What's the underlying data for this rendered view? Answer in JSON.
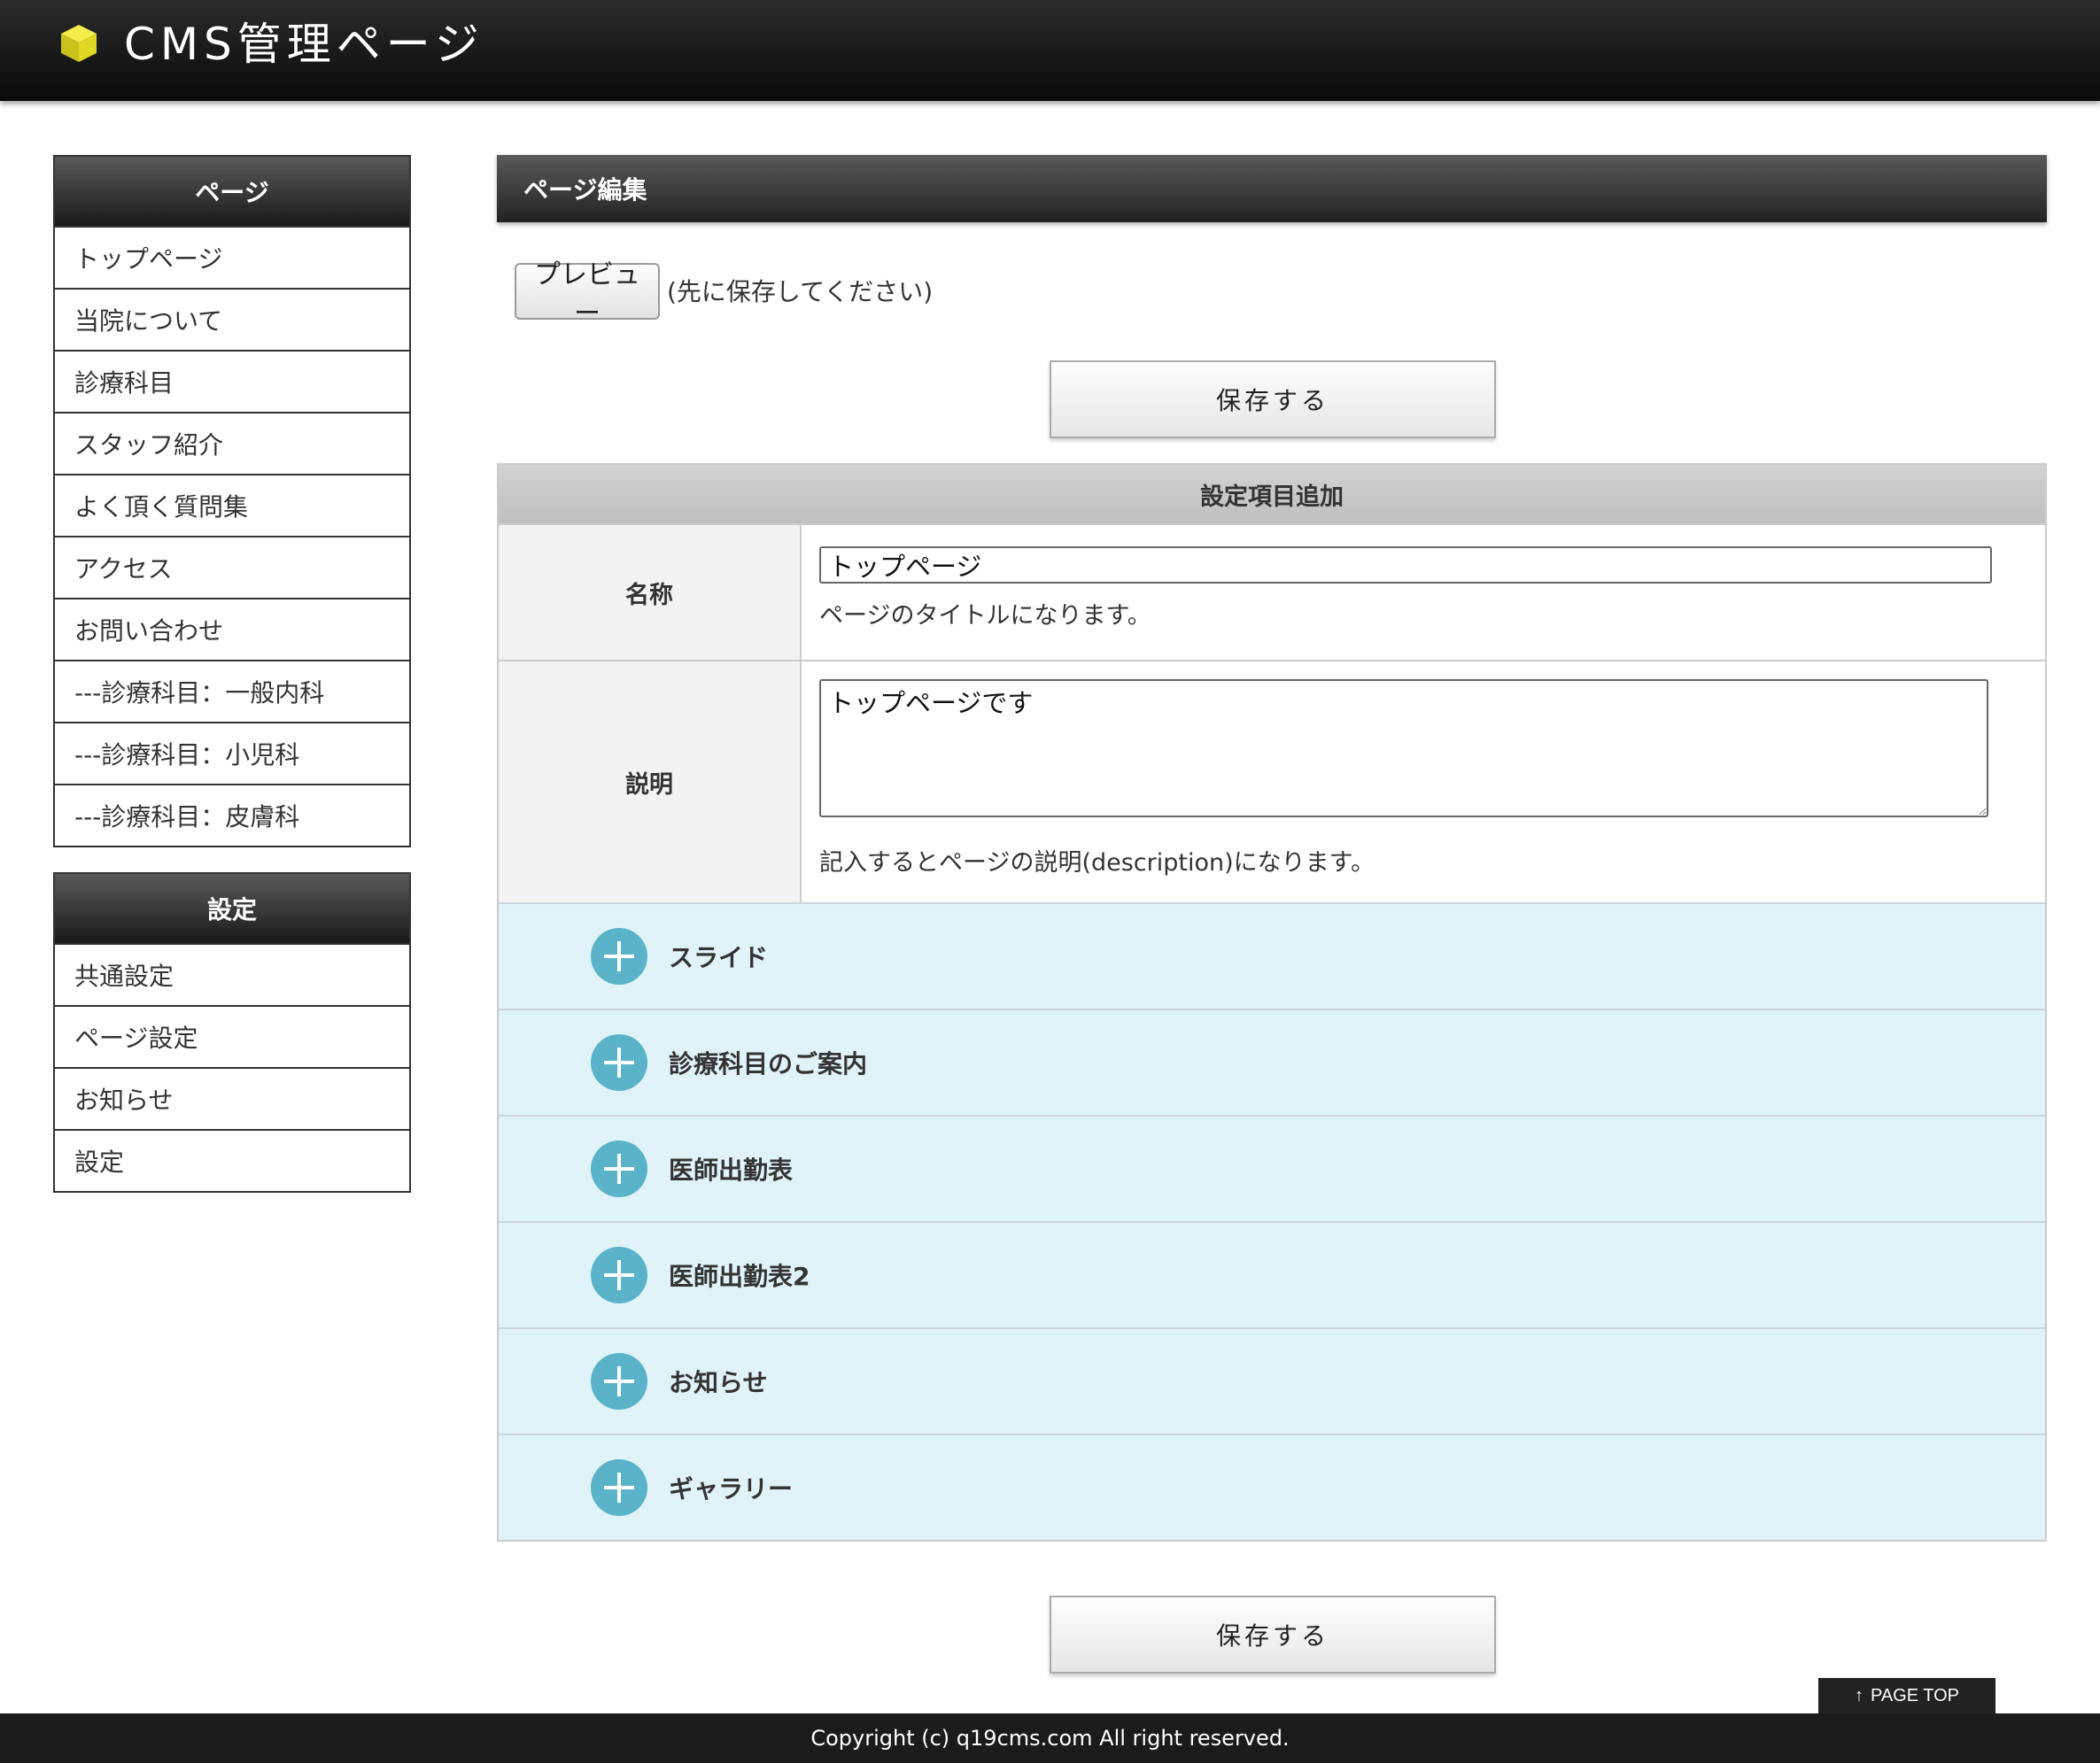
{
  "header": {
    "title": "CMS管理ページ",
    "logo_icon": "yellow-cube-icon",
    "background": "#111111"
  },
  "sidebar": {
    "pages_heading": "ページ",
    "pages": [
      "トップページ",
      "当院について",
      "診療科目",
      "スタッフ紹介",
      "よく頂く質問集",
      "アクセス",
      "お問い合わせ",
      "---診療科目：一般内科",
      "---診療科目：小児科",
      "---診療科目：皮膚科"
    ],
    "settings_heading": "設定",
    "settings": [
      "共通設定",
      "ページ設定",
      "お知らせ",
      "設定"
    ]
  },
  "main": {
    "section_title": "ページ編集",
    "preview_label": "プレビュー",
    "preview_note": "(先に保存してください)",
    "save_label": "保存する",
    "settings_title": "設定項目追加",
    "name_label": "名称",
    "name_value": "トップページ",
    "name_help": "ページのタイトルになります。",
    "desc_label": "説明",
    "desc_value": "トップページです",
    "desc_help": "記入するとページの説明(description)になります。",
    "sections": [
      "スライド",
      "診療科目のご案内",
      "医師出勤表",
      "医師出勤表2",
      "お知らせ",
      "ギャラリー"
    ],
    "accent_color": "#5ab3c9",
    "section_bg": "#e0f3f9"
  },
  "page_top_label": "PAGE TOP",
  "footer": "Copyright (c) q19cms.com All right reserved."
}
